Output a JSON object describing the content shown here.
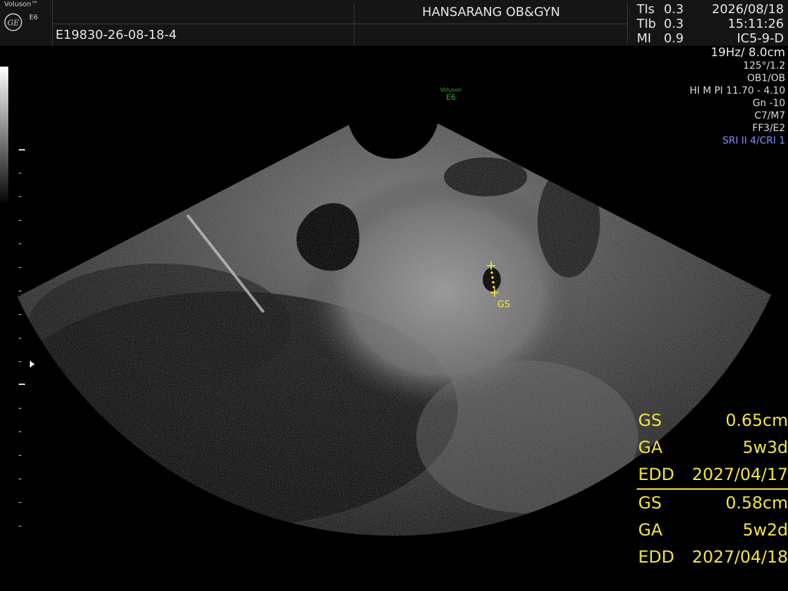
{
  "header": {
    "brand": "Voluson™",
    "model_small": "E6",
    "patient_id": "E19830-26-08-18-4",
    "hospital": "HANSARANG OB&GYN",
    "indices": [
      {
        "label": "TIs",
        "value": "0.3"
      },
      {
        "label": "TIb",
        "value": "0.3"
      },
      {
        "label": "MI",
        "value": "0.9"
      }
    ],
    "date": "2026/08/18",
    "time": "15:11:26",
    "probe": "IC5-9-D"
  },
  "parameters": {
    "frame_depth": "19Hz/ 8.0cm",
    "angle": "125°/1.2",
    "preset": "OB1/OB",
    "harmonic": "HI M PI 11.70 - 4.10",
    "gain": "Gn -10",
    "contrast": "C7/M7",
    "filter": "FF3/E2",
    "sri": "SRI II 4/CRI 1"
  },
  "watermark": {
    "line1": "Voluson",
    "line2": "E6"
  },
  "caliper_label": "GS",
  "measurements": [
    [
      {
        "label": "GS",
        "value": "0.65cm"
      },
      {
        "label": "GA",
        "value": "5w3d"
      },
      {
        "label": "EDD",
        "value": "2027/04/17"
      }
    ],
    [
      {
        "label": "GS",
        "value": "0.58cm"
      },
      {
        "label": "GA",
        "value": "5w2d"
      },
      {
        "label": "EDD",
        "value": "2027/04/18"
      }
    ]
  ],
  "colors": {
    "measurement": "#f2e63c",
    "sri": "#8a8cff",
    "watermark": "#25b325"
  }
}
